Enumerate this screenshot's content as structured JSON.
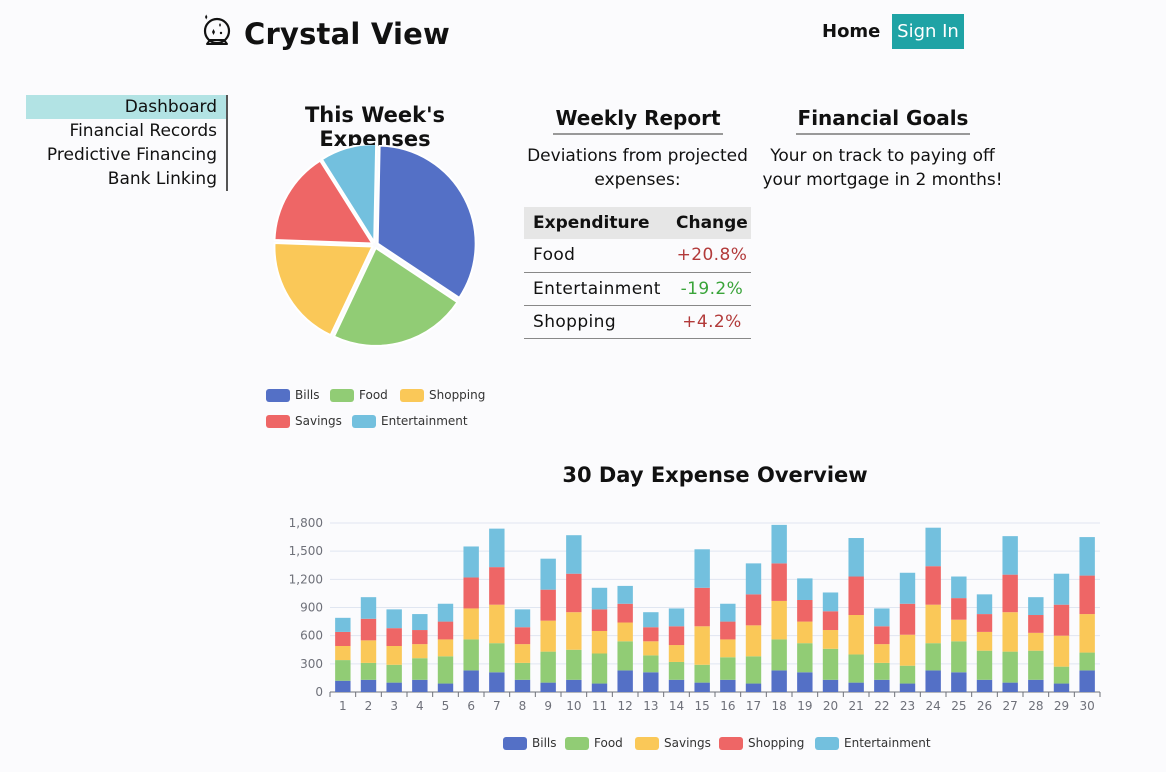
{
  "header": {
    "brand_title": "Crystal View",
    "brand_icon": "crystal-ball-icon",
    "nav_home": "Home",
    "nav_signin": "Sign In",
    "accent_color": "#1fa3a5"
  },
  "sidebar": {
    "items": [
      {
        "label": "Dashboard",
        "active": true
      },
      {
        "label": "Financial Records"
      },
      {
        "label": "Predictive Financing"
      },
      {
        "label": "Bank Linking"
      }
    ]
  },
  "weekly_pie": {
    "title": "This Week's Expenses"
  },
  "weekly_report": {
    "title": "Weekly Report",
    "subtitle_line1": "Deviations from projected",
    "subtitle_line2": "expenses:",
    "col_expenditure": "Expenditure",
    "col_change": "Change",
    "rows": [
      {
        "expenditure": "Food",
        "change": "+20.8%",
        "status": "pos"
      },
      {
        "expenditure": "Entertainment",
        "change": "-19.2%",
        "status": "neg"
      },
      {
        "expenditure": "Shopping",
        "change": "+4.2%",
        "status": "pos"
      }
    ]
  },
  "goals": {
    "title": "Financial Goals",
    "line1": "Your on track to paying off",
    "line2": "your mortgage in 2 months!"
  },
  "overview": {
    "title": "30 Day Expense Overview"
  },
  "chart_data": [
    {
      "type": "pie",
      "title": "This Week's Expenses",
      "categories": [
        "Bills",
        "Food",
        "Shopping",
        "Savings",
        "Entertainment"
      ],
      "values": [
        33,
        22,
        18,
        15,
        9
      ],
      "colors": [
        "#5470c6",
        "#91cc75",
        "#fac858",
        "#ee6666",
        "#73c0de"
      ],
      "legend_position": "bottom",
      "legend": [
        "Bills",
        "Food",
        "Shopping",
        "Savings",
        "Entertainment"
      ]
    },
    {
      "type": "bar",
      "stacked": true,
      "title": "30 Day Expense Overview",
      "categories": [
        "1",
        "2",
        "3",
        "4",
        "5",
        "6",
        "7",
        "8",
        "9",
        "10",
        "11",
        "12",
        "13",
        "14",
        "15",
        "16",
        "17",
        "18",
        "19",
        "20",
        "21",
        "22",
        "23",
        "24",
        "25",
        "26",
        "27",
        "28",
        "29",
        "30"
      ],
      "ylim": [
        0,
        1800
      ],
      "yticks": [
        "0",
        "300",
        "600",
        "900",
        "1,200",
        "1,500",
        "1,800"
      ],
      "ytick_values": [
        0,
        300,
        600,
        900,
        1200,
        1500,
        1800
      ],
      "grid": true,
      "legend_position": "bottom",
      "series": [
        {
          "name": "Bills",
          "color": "#5470c6",
          "values": [
            120,
            130,
            100,
            130,
            90,
            230,
            210,
            130,
            100,
            130,
            90,
            230,
            210,
            130,
            100,
            130,
            90,
            230,
            210,
            130,
            100,
            130,
            90,
            230,
            210,
            130,
            100,
            130,
            90,
            230
          ]
        },
        {
          "name": "Food",
          "color": "#91cc75",
          "values": [
            220,
            180,
            190,
            230,
            290,
            330,
            310,
            180,
            330,
            320,
            320,
            310,
            180,
            190,
            190,
            240,
            290,
            330,
            310,
            330,
            300,
            180,
            190,
            290,
            330,
            310,
            330,
            310,
            180,
            190
          ]
        },
        {
          "name": "Savings",
          "color": "#fac858",
          "values": [
            150,
            240,
            200,
            150,
            180,
            330,
            410,
            200,
            330,
            400,
            240,
            200,
            150,
            180,
            410,
            190,
            330,
            410,
            230,
            200,
            420,
            200,
            330,
            410,
            230,
            200,
            420,
            190,
            330,
            410
          ]
        },
        {
          "name": "Shopping",
          "color": "#ee6666",
          "values": [
            150,
            230,
            190,
            150,
            190,
            330,
            400,
            180,
            330,
            410,
            230,
            200,
            150,
            200,
            410,
            190,
            330,
            400,
            230,
            200,
            410,
            190,
            330,
            410,
            230,
            190,
            400,
            190,
            330,
            410
          ]
        },
        {
          "name": "Entertainment",
          "color": "#73c0de",
          "values": [
            150,
            230,
            200,
            170,
            190,
            330,
            410,
            190,
            330,
            410,
            230,
            190,
            160,
            190,
            410,
            190,
            330,
            410,
            230,
            200,
            410,
            190,
            330,
            410,
            230,
            210,
            410,
            190,
            330,
            410
          ]
        }
      ]
    }
  ]
}
